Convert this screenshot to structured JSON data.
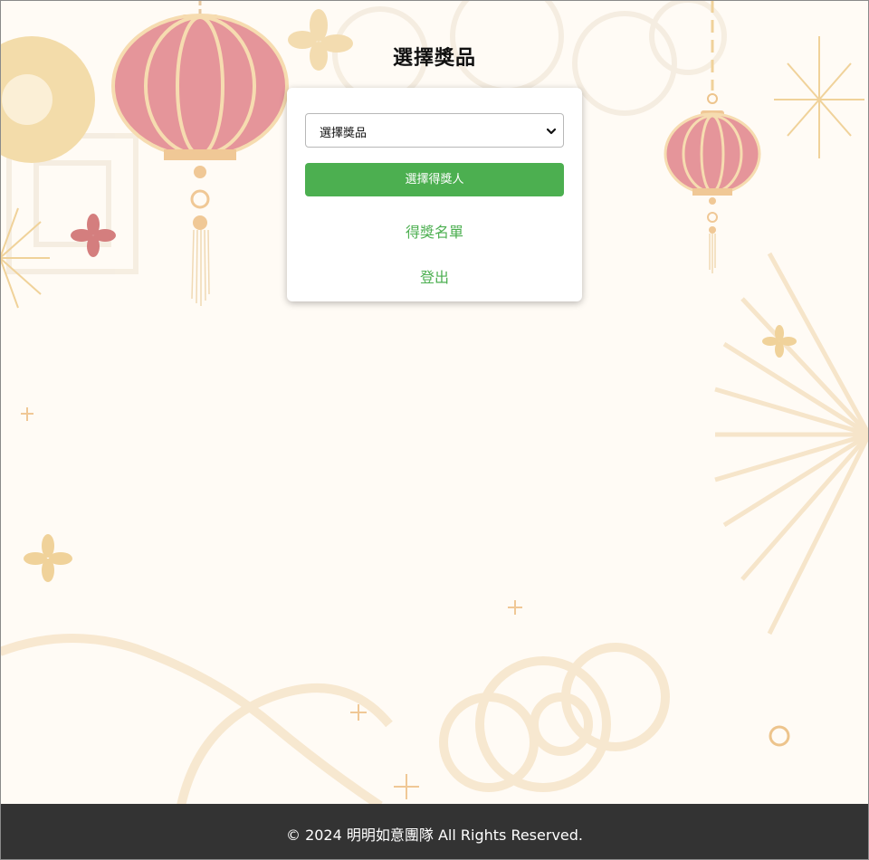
{
  "page": {
    "title": "選擇獎品"
  },
  "form": {
    "prize_select": {
      "selected": "選擇獎品",
      "icon": "chevron-down-icon"
    },
    "draw_button_label": "選擇得獎人",
    "winners_link": "得獎名單",
    "logout_link": "登出"
  },
  "footer": {
    "copyright": "© 2024 明明如意團隊 All Rights Reserved."
  },
  "colors": {
    "accent": "#4caf50",
    "background": "#fffbf5",
    "lantern": "#e5959a",
    "gold": "#f0d29a",
    "footer_bg": "#333333"
  }
}
